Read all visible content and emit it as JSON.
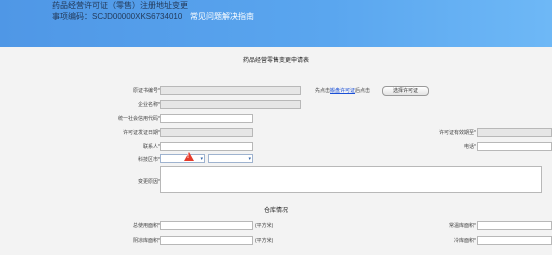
{
  "header": {
    "title": "药品经营许可证（零售）注册地址变更",
    "item_code": "事项编码：SCJD00000XKS6734010",
    "faq": "常见问题解决指南"
  },
  "form": {
    "title": "药品经营零售变更申请表",
    "labels": {
      "orig_cert_no": "原证书编号*",
      "company_name": "企业名称*",
      "credit_code": "统一社会信用代码*",
      "issue_date": "许可证发证日期*",
      "contact": "联系人*",
      "district": "科技区市*",
      "change_reason": "变更原因*",
      "validity": "许可证有效期至*",
      "phone": "电话*"
    },
    "hint_prefix": "先点击",
    "hint_link": "搬盘许可证",
    "hint_suffix": "后点击",
    "select_license_button": "选择许可证"
  },
  "warehouse": {
    "title": "仓库情况",
    "labels": {
      "total_area": "总使用面积*",
      "yin_area": "阴凉库面积*",
      "normal_area": "常温库面积*",
      "cold_area": "冷库面积*"
    },
    "unit": "(平方米)"
  },
  "colors": {
    "header_start": "#4f97e6",
    "header_end": "#6eb8f6",
    "link": "#1a4fd6",
    "warning": "#e53a2a"
  },
  "icons": {
    "warning": "warning-triangle-icon",
    "dropdown": "chevron-down-icon"
  }
}
